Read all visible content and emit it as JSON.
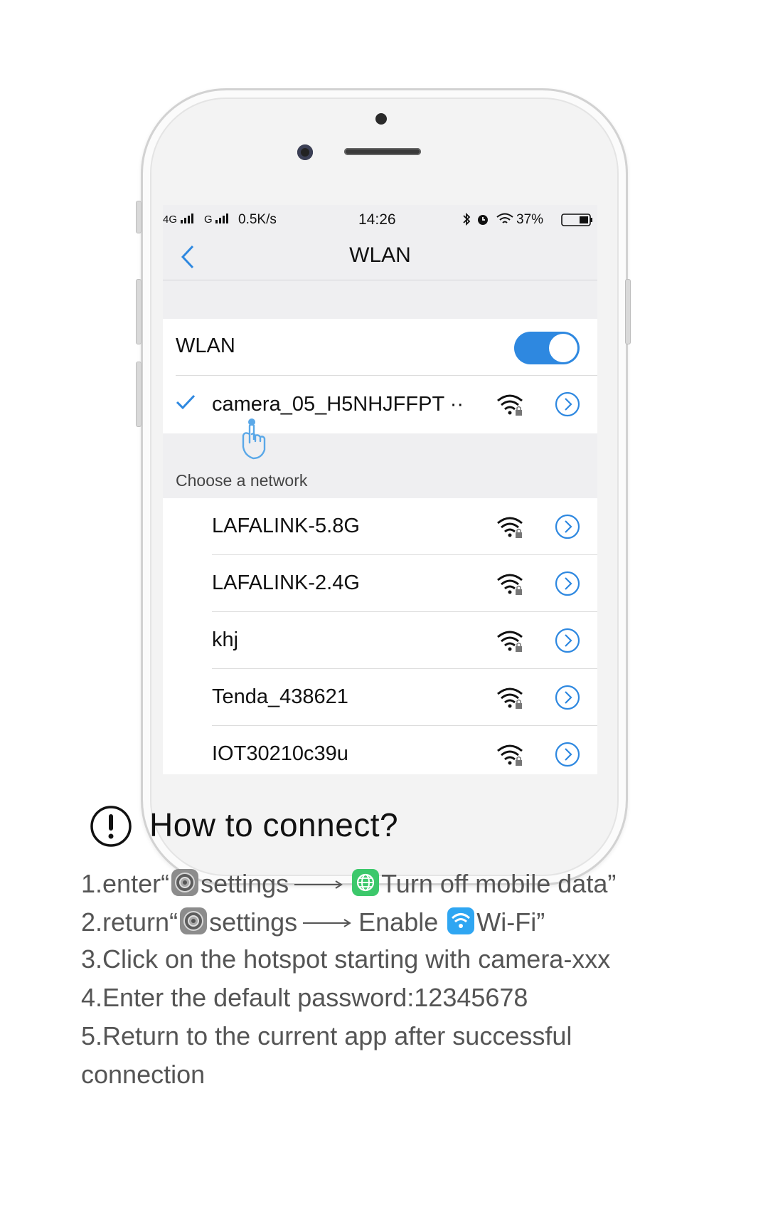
{
  "status_bar": {
    "network1": "4G",
    "network2": "G",
    "speed": "0.5K/s",
    "time": "14:26",
    "battery": "37%"
  },
  "nav": {
    "title": "WLAN"
  },
  "wlan": {
    "label": "WLAN",
    "enabled": true,
    "connected_network": "camera_05_H5NHJFFPT ··"
  },
  "choose_label": "Choose a network",
  "networks": [
    {
      "name": "LAFALINK-5.8G"
    },
    {
      "name": "LAFALINK-2.4G"
    },
    {
      "name": "khj"
    },
    {
      "name": "Tenda_438621"
    },
    {
      "name": "IOT30210c39u"
    }
  ],
  "howto": {
    "title": "How to connect?",
    "step1": {
      "a": "1.enter“",
      "b": "settings",
      "c": "Turn off mobile data”"
    },
    "step2": {
      "a": "2.return“",
      "b": "settings",
      "c": "Enable",
      "d": "Wi-Fi”"
    },
    "step3": "3.Click on the hotspot starting with camera-xxx",
    "step4": "4.Enter the default password:12345678",
    "step5a": "5.Return to the current app after successful",
    "step5b": "connection"
  },
  "colors": {
    "accent": "#2e88e0",
    "text_gray": "#555555",
    "screen_bg": "#efeff1"
  },
  "icons": [
    "back-chevron-icon",
    "check-icon",
    "wifi-lock-icon",
    "info-circle-icon",
    "pointer-hand-icon",
    "alert-circle-icon",
    "settings-gear-icon",
    "globe-app-icon",
    "wifi-app-icon",
    "arrow-right-icon"
  ]
}
